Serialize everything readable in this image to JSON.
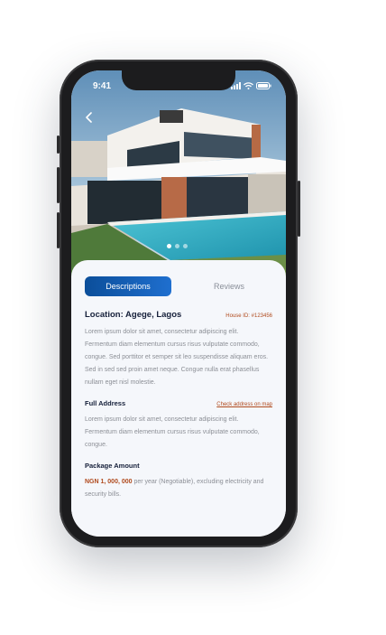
{
  "status_bar": {
    "time": "9:41"
  },
  "tabs": {
    "active": "Descriptions",
    "inactive": "Reviews"
  },
  "listing": {
    "location": "Location: Agege, Lagos",
    "house_id": "House ID: #123456",
    "description": "Lorem ipsum dolor sit amet, consectetur adipiscing elit. Fermentum diam elementum cursus risus vulputate commodo, congue. Sed porttitor et semper sit leo suspendisse aliquam eros. Sed in sed sed proin amet neque. Congue nulla erat phasellus nullam eget nisl molestie."
  },
  "address": {
    "title": "Full Address",
    "map_link": "Check address on map",
    "text": "Lorem ipsum dolor sit amet, consectetur adipiscing elit. Fermentum diam elementum cursus risus vulputate commodo, congue."
  },
  "package": {
    "title": "Package Amount",
    "price": "NGN 1, 000, 000",
    "terms": " per year (Negotiable), excluding electricity and security bills."
  },
  "carousel": {
    "total": 3,
    "active_index": 0
  },
  "colors": {
    "accent": "#0b4e9a",
    "highlight": "#b04a1d",
    "heading": "#16203a"
  },
  "icons": [
    "back-chevron-icon",
    "signal-icon",
    "wifi-icon",
    "battery-icon"
  ]
}
